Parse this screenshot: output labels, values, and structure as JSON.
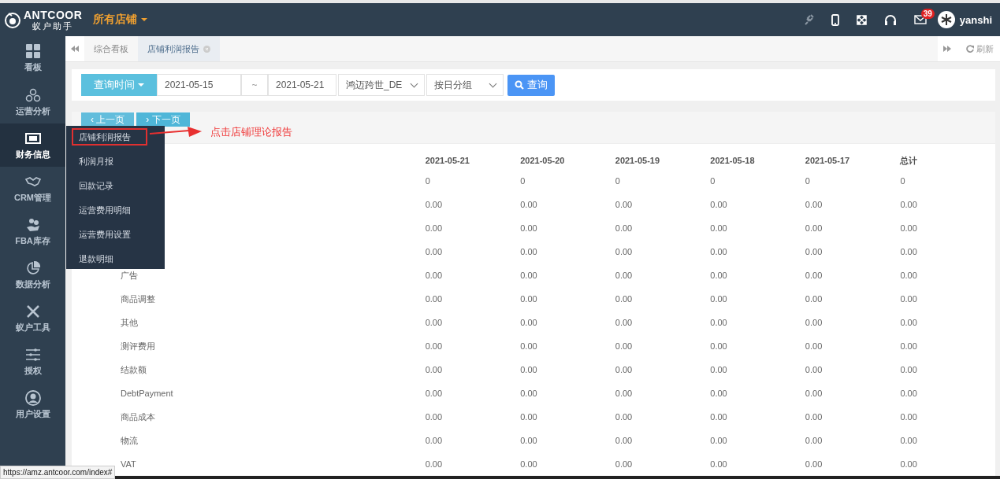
{
  "header": {
    "logo": "ANTCOOR",
    "logo_sub": "蚁户助手",
    "store_menu": "所有店铺",
    "mail_badge": "39",
    "user": "yanshi"
  },
  "sidebar": {
    "items": [
      {
        "label": "看板",
        "selected": false
      },
      {
        "label": "运营分析",
        "selected": false
      },
      {
        "label": "财务信息",
        "selected": true
      },
      {
        "label": "CRM管理",
        "selected": false
      },
      {
        "label": "FBA库存",
        "selected": false
      },
      {
        "label": "数据分析",
        "selected": false
      },
      {
        "label": "蚁户工具",
        "selected": false
      },
      {
        "label": "授权",
        "selected": false
      },
      {
        "label": "用户设置",
        "selected": false
      }
    ]
  },
  "submenu": {
    "items": [
      {
        "label": "店铺利润报告",
        "highlighted": true
      },
      {
        "label": "利润月报",
        "highlighted": false
      },
      {
        "label": "回款记录",
        "highlighted": false
      },
      {
        "label": "运营费用明细",
        "highlighted": false
      },
      {
        "label": "运营费用设置",
        "highlighted": false
      },
      {
        "label": "退款明细",
        "highlighted": false
      }
    ]
  },
  "annotation": {
    "text": "点击店铺理论报告"
  },
  "tabs": [
    {
      "label": "综合看板",
      "selected": false,
      "closable": false
    },
    {
      "label": "店铺利润报告",
      "selected": true,
      "closable": true
    }
  ],
  "refresh": "刷新",
  "query": {
    "time_button": "查询时间",
    "start": "2021-05-15",
    "separator": "~",
    "end": "2021-05-21",
    "store": "鸿迈跨世_DE",
    "grouping": "按日分组",
    "search": "查询"
  },
  "pager": {
    "prev": "‹ 上一页",
    "next": "› 下一页"
  },
  "table": {
    "columns": [
      "2021-05-21",
      "2021-05-20",
      "2021-05-19",
      "2021-05-18",
      "2021-05-17",
      "总计"
    ],
    "rows": [
      {
        "values": [
          "0",
          "0",
          "0",
          "0",
          "0",
          "0"
        ]
      },
      {
        "values": [
          "0.00",
          "0.00",
          "0.00",
          "0.00",
          "0.00",
          "0.00"
        ]
      },
      {
        "values": [
          "0.00",
          "0.00",
          "0.00",
          "0.00",
          "0.00",
          "0.00"
        ]
      },
      {
        "values": [
          "0.00",
          "0.00",
          "0.00",
          "0.00",
          "0.00",
          "0.00"
        ]
      },
      {
        "label": "广告",
        "values": [
          "0.00",
          "0.00",
          "0.00",
          "0.00",
          "0.00",
          "0.00"
        ]
      },
      {
        "label": "商品调整",
        "values": [
          "0.00",
          "0.00",
          "0.00",
          "0.00",
          "0.00",
          "0.00"
        ]
      },
      {
        "label": "其他",
        "values": [
          "0.00",
          "0.00",
          "0.00",
          "0.00",
          "0.00",
          "0.00"
        ]
      },
      {
        "label": "测评费用",
        "values": [
          "0.00",
          "0.00",
          "0.00",
          "0.00",
          "0.00",
          "0.00"
        ]
      },
      {
        "label": "结款额",
        "values": [
          "0.00",
          "0.00",
          "0.00",
          "0.00",
          "0.00",
          "0.00"
        ]
      },
      {
        "label": "DebtPayment",
        "values": [
          "0.00",
          "0.00",
          "0.00",
          "0.00",
          "0.00",
          "0.00"
        ]
      },
      {
        "label": "商品成本",
        "values": [
          "0.00",
          "0.00",
          "0.00",
          "0.00",
          "0.00",
          "0.00"
        ]
      },
      {
        "label": "物流",
        "values": [
          "0.00",
          "0.00",
          "0.00",
          "0.00",
          "0.00",
          "0.00"
        ]
      },
      {
        "label": "VAT",
        "values": [
          "0.00",
          "0.00",
          "0.00",
          "0.00",
          "0.00",
          "0.00"
        ]
      }
    ]
  },
  "status_url": "https://amz.antcoor.com/index#"
}
